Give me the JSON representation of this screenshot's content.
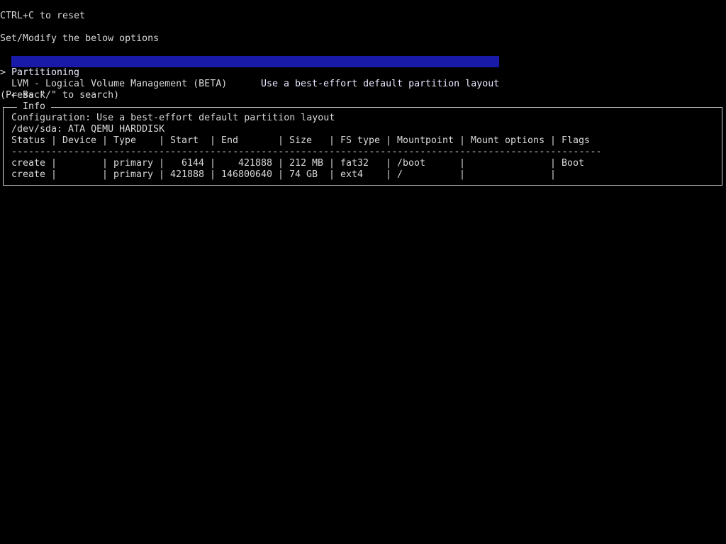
{
  "header": {
    "reset_hint": "CTRL+C to reset",
    "instruction": "Set/Modify the below options"
  },
  "menu": {
    "cursor": ">",
    "items": [
      {
        "label": "Partitioning",
        "description": "Use a best-effort default partition layout",
        "selected": true
      },
      {
        "label": "LVM - Logical Volume Management (BETA)",
        "description": "",
        "selected": false
      },
      {
        "label": "← Back",
        "description": "",
        "selected": false
      }
    ],
    "search_hint": "(Press \"/\" to search)"
  },
  "info": {
    "title": "Info",
    "configuration": "Configuration: Use a best-effort default partition layout",
    "device": "/dev/sda: ATA QEMU HARDDISK",
    "columns": [
      "Status",
      "Device",
      "Type",
      "Start",
      "End",
      "Size",
      "FS type",
      "Mountpoint",
      "Mount options",
      "Flags"
    ],
    "rule": "------------------------------------------------------------------------------------------------------------",
    "rows": [
      {
        "status": "create",
        "device": "",
        "type": "primary",
        "start": "6144",
        "end": "421888",
        "size": "212 MB",
        "fstype": "fat32",
        "mountpoint": "/boot",
        "mount_options": "",
        "flags": "Boot"
      },
      {
        "status": "create",
        "device": "",
        "type": "primary",
        "start": "421888",
        "end": "146800640",
        "size": "74 GB",
        "fstype": "ext4",
        "mountpoint": "/",
        "mount_options": "",
        "flags": ""
      }
    ]
  },
  "colors": {
    "background": "#000000",
    "text": "#d8d8d8",
    "selection": "#1a1aa8"
  }
}
